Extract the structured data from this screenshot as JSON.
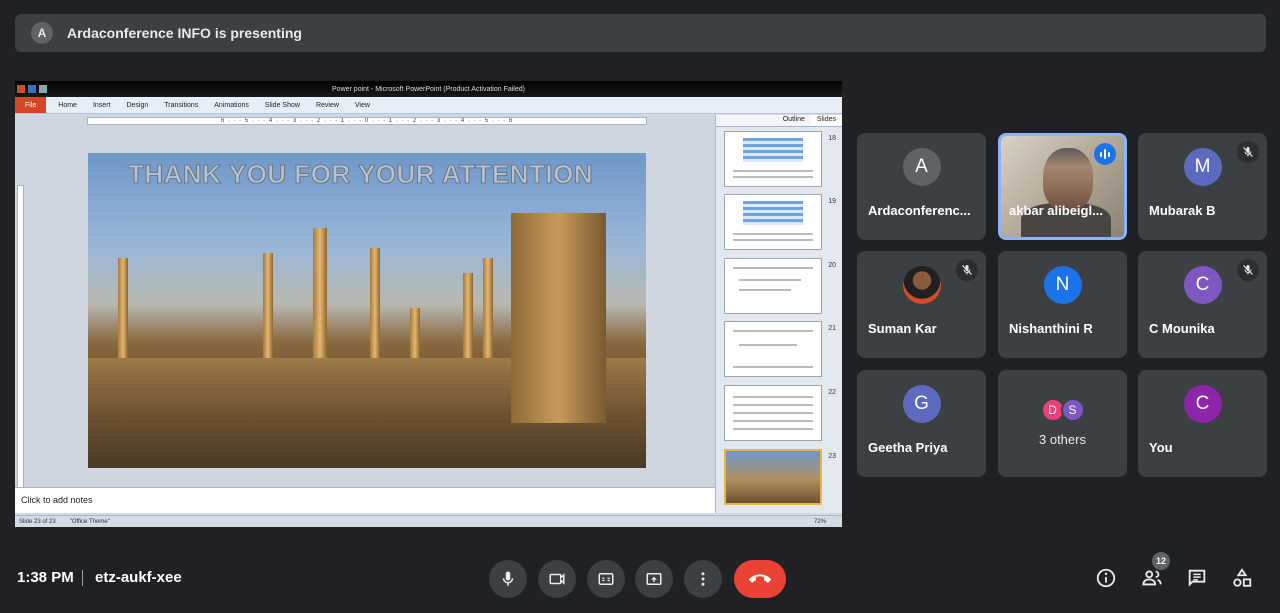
{
  "banner": {
    "initial": "A",
    "text": "Ardaconference INFO is presenting"
  },
  "powerpoint": {
    "window_title": "Power point - Microsoft PowerPoint (Product Activation Failed)",
    "tabs": [
      "File",
      "Home",
      "Insert",
      "Design",
      "Transitions",
      "Animations",
      "Slide Show",
      "Review",
      "View"
    ],
    "ruler_text": "6 · · · 5 · · · 4 · · · 3 · · · 2 · · · 1 · · · 0 · · · 1 · · · 2 · · · 3 · · · 4 · · · 5 · · · 6",
    "slide_title": "THANK YOU FOR YOUR ATTENTION",
    "notes_placeholder": "Click to add notes",
    "panel_tabs": {
      "outline": "Outline",
      "slides": "Slides"
    },
    "slide_numbers": [
      "18",
      "19",
      "20",
      "21",
      "22",
      "23"
    ],
    "status": {
      "slide": "Slide 23 of 23",
      "theme": "\"Office Theme\"",
      "zoom": "72%"
    }
  },
  "participants": [
    {
      "name": "Ardaconferenc...",
      "initial": "A",
      "color": "#5f6368",
      "muted": false
    },
    {
      "name": "akbar alibeigl...",
      "video": true,
      "speaking": true
    },
    {
      "name": "Mubarak B",
      "initial": "M",
      "color": "#5c6bc0",
      "muted": true
    },
    {
      "name": "Suman Kar",
      "photo": true,
      "muted": true
    },
    {
      "name": "Nishanthini R",
      "initial": "N",
      "color": "#1a73e8",
      "muted": false
    },
    {
      "name": "C Mounika",
      "initial": "C",
      "color": "#7e57c2",
      "muted": true
    },
    {
      "name": "Geetha Priya",
      "initial": "G",
      "color": "#5c6bc0",
      "muted": false
    },
    {
      "others_label": "3 others",
      "initials": [
        "D",
        "S"
      ],
      "colors": [
        "#ec407a",
        "#7e57c2"
      ]
    },
    {
      "name": "You",
      "initial": "C",
      "color": "#8e24aa",
      "muted": false
    }
  ],
  "bottom": {
    "time": "1:38 PM",
    "meeting_code": "etz-aukf-xee",
    "people_count": "12"
  },
  "colors": {
    "background": "#202124",
    "tile": "#3c4043",
    "end_call": "#ea4335",
    "speaking": "#8ab4f8"
  }
}
